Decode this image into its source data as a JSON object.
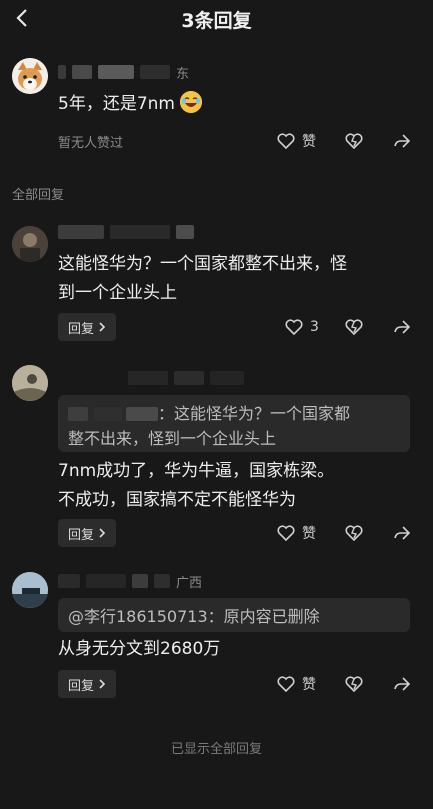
{
  "header": {
    "title": "3条回复"
  },
  "main_comment": {
    "region": "东",
    "text": "5年，还是7nm",
    "meta": "暂无人赞过",
    "like_label": "赞"
  },
  "section_label": "全部回复",
  "replies": [
    {
      "text_line1": "这能怪华为？一个国家都整不出来，怪",
      "text_line2": "到一个企业头上",
      "reply_label": "回复",
      "like_count": "3"
    },
    {
      "quote_line1": "：这能怪华为？一个国家都",
      "quote_line2": "整不出来，怪到一个企业头上",
      "text_line1": "7nm成功了，华为牛逼，国家栋梁。",
      "text_line2": "不成功，国家搞不定不能怪华为",
      "reply_label": "回复",
      "like_label": "赞"
    },
    {
      "region": "广西",
      "quote": "@李行186150713：原内容已删除",
      "text": "从身无分文到2680万",
      "reply_label": "回复",
      "like_label": "赞"
    }
  ],
  "footer": "已显示全部回复",
  "icons": {
    "back": "back-arrow-icon",
    "like": "heart-icon",
    "dislike": "broken-heart-icon",
    "share": "share-icon",
    "chevron": "chevron-right-icon"
  },
  "colors": {
    "background": "#181818",
    "text": "#eeeeee",
    "muted": "#8a8a8a"
  }
}
